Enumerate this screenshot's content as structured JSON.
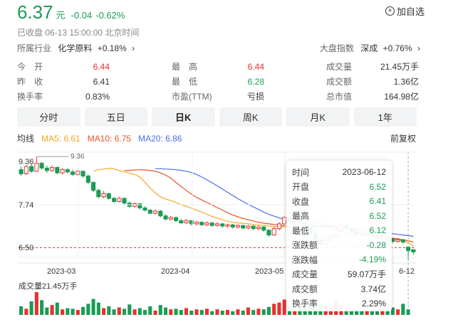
{
  "quote": {
    "price": "6.37",
    "unit": "元",
    "change": "-0.04",
    "change_pct": "-0.62%",
    "watch_label": "加自选",
    "status": "已收盘  06-13 15:00:00  北京时间"
  },
  "industry": {
    "label": "所属行业",
    "name": "化学原料",
    "change": "+0.18%",
    "chevron": "›"
  },
  "index": {
    "label": "大盘指数",
    "name": "深成",
    "change": "+0.76%",
    "chevron": "›"
  },
  "stats": {
    "open_label": "今　开",
    "open": "6.44",
    "high_label": "最　高",
    "high": "6.44",
    "volume_label": "成交量",
    "volume": "21.45万手",
    "prev_label": "昨　收",
    "prev": "6.41",
    "low_label": "最　低",
    "low": "6.28",
    "amount_label": "成交额",
    "amount": "1.36亿",
    "turnover_label": "换手率",
    "turnover": "0.83%",
    "pe_label": "市盈(TTM)",
    "pe": "亏损",
    "mcap_label": "总市值",
    "mcap": "164.98亿"
  },
  "tabs": [
    "分时",
    "五日",
    "日K",
    "周K",
    "月K",
    "1年"
  ],
  "active_tab": 2,
  "ma": {
    "label": "均线",
    "ma5": "MA5: 6.61",
    "ma10": "MA10: 6.75",
    "ma20": "MA20: 6.86",
    "adjust": "前复权"
  },
  "colors": {
    "up": "#e93030",
    "down": "#1a9c56",
    "ma5": "#f5a623",
    "ma10": "#e8542a",
    "ma20": "#4a6ee0"
  },
  "chart": {
    "y_labels": [
      "9.36",
      "7.74",
      "6.50"
    ],
    "high_marker": "9.36",
    "x_labels": [
      "2023-03",
      "2023-04",
      "2023-05",
      "6-12"
    ],
    "volume_label": "成交量21.45万手"
  },
  "chart_data": {
    "type": "candlestick",
    "ylim": [
      6.2,
      9.5
    ],
    "candles": [
      {
        "o": 8.95,
        "c": 8.82,
        "h": 9.05,
        "l": 8.75
      },
      {
        "o": 8.82,
        "c": 9.05,
        "h": 9.1,
        "l": 8.78
      },
      {
        "o": 9.05,
        "c": 8.9,
        "h": 9.12,
        "l": 8.85
      },
      {
        "o": 8.9,
        "c": 9.15,
        "h": 9.36,
        "l": 8.88
      },
      {
        "o": 9.15,
        "c": 9.0,
        "h": 9.2,
        "l": 8.95
      },
      {
        "o": 9.0,
        "c": 8.92,
        "h": 9.08,
        "l": 8.85
      },
      {
        "o": 8.92,
        "c": 9.02,
        "h": 9.08,
        "l": 8.88
      },
      {
        "o": 9.02,
        "c": 8.85,
        "h": 9.05,
        "l": 8.8
      },
      {
        "o": 8.85,
        "c": 8.95,
        "h": 9.0,
        "l": 8.8
      },
      {
        "o": 8.95,
        "c": 8.88,
        "h": 9.0,
        "l": 8.82
      },
      {
        "o": 8.88,
        "c": 8.8,
        "h": 8.95,
        "l": 8.75
      },
      {
        "o": 8.8,
        "c": 8.9,
        "h": 8.95,
        "l": 8.76
      },
      {
        "o": 8.9,
        "c": 8.75,
        "h": 8.92,
        "l": 8.7
      },
      {
        "o": 8.75,
        "c": 8.55,
        "h": 8.8,
        "l": 8.5
      },
      {
        "o": 8.55,
        "c": 8.3,
        "h": 8.58,
        "l": 8.25
      },
      {
        "o": 8.3,
        "c": 8.1,
        "h": 8.35,
        "l": 8.05
      },
      {
        "o": 8.1,
        "c": 8.2,
        "h": 8.28,
        "l": 8.05
      },
      {
        "o": 8.2,
        "c": 8.05,
        "h": 8.22,
        "l": 8.0
      },
      {
        "o": 8.05,
        "c": 7.95,
        "h": 8.1,
        "l": 7.9
      },
      {
        "o": 7.95,
        "c": 8.05,
        "h": 8.1,
        "l": 7.92
      },
      {
        "o": 8.05,
        "c": 7.9,
        "h": 8.08,
        "l": 7.85
      },
      {
        "o": 7.9,
        "c": 7.8,
        "h": 7.95,
        "l": 7.75
      },
      {
        "o": 7.8,
        "c": 7.88,
        "h": 7.92,
        "l": 7.76
      },
      {
        "o": 7.88,
        "c": 7.75,
        "h": 7.9,
        "l": 7.7
      },
      {
        "o": 7.75,
        "c": 7.68,
        "h": 7.8,
        "l": 7.64
      },
      {
        "o": 7.68,
        "c": 7.58,
        "h": 7.72,
        "l": 7.55
      },
      {
        "o": 7.58,
        "c": 7.65,
        "h": 7.7,
        "l": 7.55
      },
      {
        "o": 7.65,
        "c": 7.5,
        "h": 7.68,
        "l": 7.45
      },
      {
        "o": 7.5,
        "c": 7.4,
        "h": 7.55,
        "l": 7.36
      },
      {
        "o": 7.4,
        "c": 7.45,
        "h": 7.5,
        "l": 7.35
      },
      {
        "o": 7.45,
        "c": 7.35,
        "h": 7.48,
        "l": 7.3
      },
      {
        "o": 7.35,
        "c": 7.28,
        "h": 7.4,
        "l": 7.25
      },
      {
        "o": 7.28,
        "c": 7.35,
        "h": 7.4,
        "l": 7.25
      },
      {
        "o": 7.35,
        "c": 7.25,
        "h": 7.38,
        "l": 7.2
      },
      {
        "o": 7.25,
        "c": 7.3,
        "h": 7.35,
        "l": 7.2
      },
      {
        "o": 7.3,
        "c": 7.22,
        "h": 7.33,
        "l": 7.18
      },
      {
        "o": 7.22,
        "c": 7.28,
        "h": 7.32,
        "l": 7.18
      },
      {
        "o": 7.28,
        "c": 7.2,
        "h": 7.3,
        "l": 7.15
      },
      {
        "o": 7.2,
        "c": 7.25,
        "h": 7.3,
        "l": 7.16
      },
      {
        "o": 7.25,
        "c": 7.18,
        "h": 7.28,
        "l": 7.12
      },
      {
        "o": 7.18,
        "c": 7.22,
        "h": 7.26,
        "l": 7.12
      },
      {
        "o": 7.22,
        "c": 7.15,
        "h": 7.25,
        "l": 7.1
      },
      {
        "o": 7.15,
        "c": 7.2,
        "h": 7.24,
        "l": 7.1
      },
      {
        "o": 7.2,
        "c": 7.12,
        "h": 7.22,
        "l": 7.08
      },
      {
        "o": 7.12,
        "c": 7.18,
        "h": 7.22,
        "l": 7.08
      },
      {
        "o": 7.18,
        "c": 7.1,
        "h": 7.2,
        "l": 7.05
      },
      {
        "o": 7.1,
        "c": 7.15,
        "h": 7.2,
        "l": 7.05
      },
      {
        "o": 7.15,
        "c": 7.05,
        "h": 7.18,
        "l": 7.0
      },
      {
        "o": 7.05,
        "c": 6.9,
        "h": 7.08,
        "l": 6.85
      },
      {
        "o": 6.9,
        "c": 7.1,
        "h": 7.15,
        "l": 6.88
      },
      {
        "o": 7.1,
        "c": 7.25,
        "h": 7.3,
        "l": 7.05
      },
      {
        "o": 7.25,
        "c": 7.45,
        "h": 7.5,
        "l": 7.2
      },
      {
        "o": 7.45,
        "c": 7.3,
        "h": 7.5,
        "l": 7.25
      },
      {
        "o": 7.3,
        "c": 7.4,
        "h": 7.45,
        "l": 7.25
      },
      {
        "o": 7.4,
        "c": 7.3,
        "h": 7.45,
        "l": 7.25
      },
      {
        "o": 7.3,
        "c": 7.15,
        "h": 7.35,
        "l": 7.1
      },
      {
        "o": 7.15,
        "c": 6.95,
        "h": 7.2,
        "l": 6.9
      },
      {
        "o": 6.95,
        "c": 6.75,
        "h": 7.0,
        "l": 6.7
      },
      {
        "o": 6.75,
        "c": 6.6,
        "h": 6.8,
        "l": 6.5
      },
      {
        "o": 6.6,
        "c": 6.72,
        "h": 6.8,
        "l": 6.55
      },
      {
        "o": 6.72,
        "c": 6.85,
        "h": 6.9,
        "l": 6.68
      },
      {
        "o": 6.85,
        "c": 7.05,
        "h": 7.1,
        "l": 6.8
      },
      {
        "o": 7.05,
        "c": 7.2,
        "h": 7.3,
        "l": 7.0
      },
      {
        "o": 7.2,
        "c": 7.1,
        "h": 7.25,
        "l": 7.05
      },
      {
        "o": 7.1,
        "c": 7.0,
        "h": 7.15,
        "l": 6.95
      },
      {
        "o": 7.0,
        "c": 6.95,
        "h": 7.05,
        "l": 6.9
      },
      {
        "o": 6.95,
        "c": 6.9,
        "h": 7.0,
        "l": 6.85
      },
      {
        "o": 6.9,
        "c": 6.95,
        "h": 7.0,
        "l": 6.85
      },
      {
        "o": 6.95,
        "c": 6.88,
        "h": 6.98,
        "l": 6.84
      },
      {
        "o": 6.88,
        "c": 6.8,
        "h": 6.9,
        "l": 6.76
      },
      {
        "o": 6.8,
        "c": 6.85,
        "h": 6.9,
        "l": 6.76
      },
      {
        "o": 6.85,
        "c": 6.78,
        "h": 6.88,
        "l": 6.72
      },
      {
        "o": 6.78,
        "c": 6.7,
        "h": 6.8,
        "l": 6.65
      },
      {
        "o": 6.7,
        "c": 6.75,
        "h": 6.8,
        "l": 6.66
      },
      {
        "o": 6.75,
        "c": 6.68,
        "h": 6.78,
        "l": 6.62
      },
      {
        "o": 6.52,
        "c": 6.41,
        "h": 6.52,
        "l": 6.12
      },
      {
        "o": 6.44,
        "c": 6.37,
        "h": 6.44,
        "l": 6.28
      }
    ],
    "volumes": [
      14,
      10,
      22,
      37,
      24,
      12,
      16,
      20,
      9,
      11,
      10,
      8,
      13,
      18,
      26,
      20,
      11,
      14,
      9,
      12,
      10,
      17,
      9,
      11,
      8,
      14,
      7,
      16,
      12,
      9,
      10,
      8,
      11,
      7,
      9,
      8,
      10,
      6,
      9,
      7,
      8,
      6,
      9,
      7,
      12,
      8,
      10,
      9,
      13,
      18,
      20,
      25,
      13,
      10,
      11,
      14,
      16,
      21,
      19,
      15,
      12,
      22,
      17,
      11,
      9,
      10,
      8,
      7,
      9,
      6,
      10,
      8,
      12,
      9,
      18,
      9
    ],
    "ma5": [
      8.9,
      8.95,
      8.97,
      8.99,
      8.98,
      8.92,
      8.88,
      8.84,
      8.8,
      8.72,
      8.55,
      8.38,
      8.22,
      8.1,
      8.03,
      7.98,
      7.92,
      7.85,
      7.8,
      7.74,
      7.68,
      7.62,
      7.55,
      7.48,
      7.43,
      7.38,
      7.33,
      7.3,
      7.28,
      7.27,
      7.25,
      7.23,
      7.21,
      7.2,
      7.18,
      7.17,
      7.16,
      7.15,
      7.12,
      7.08,
      7.05,
      7.1,
      7.2,
      7.3,
      7.33,
      7.25,
      7.1,
      6.95,
      6.85,
      6.8,
      6.85,
      6.95,
      7.0,
      6.98,
      6.95,
      6.9,
      6.86,
      6.82,
      6.78,
      6.75,
      6.72,
      6.66,
      6.55
    ],
    "ma10": [
      8.92,
      8.93,
      8.94,
      8.95,
      8.94,
      8.92,
      8.9,
      8.85,
      8.78,
      8.68,
      8.55,
      8.42,
      8.3,
      8.18,
      8.08,
      8.0,
      7.92,
      7.84,
      7.76,
      7.68,
      7.6,
      7.53,
      7.47,
      7.42,
      7.38,
      7.34,
      7.3,
      7.27,
      7.25,
      7.23,
      7.21,
      7.19,
      7.17,
      7.15,
      7.13,
      7.12,
      7.13,
      7.16,
      7.2,
      7.22,
      7.2,
      7.12,
      7.03,
      6.96,
      6.92,
      6.92,
      6.94,
      6.94,
      6.92,
      6.88,
      6.85,
      6.82,
      6.8,
      6.78,
      6.75,
      6.72,
      6.68
    ],
    "ma20": [
      8.98,
      8.98,
      8.97,
      8.96,
      8.95,
      8.93,
      8.9,
      8.86,
      8.8,
      8.72,
      8.63,
      8.54,
      8.44,
      8.34,
      8.24,
      8.14,
      8.04,
      7.95,
      7.86,
      7.78,
      7.7,
      7.62,
      7.55,
      7.49,
      7.44,
      7.39,
      7.35,
      7.31,
      7.28,
      7.25,
      7.22,
      7.2,
      7.18,
      7.17,
      7.16,
      7.15,
      7.14,
      7.12,
      7.1,
      7.08,
      7.06,
      7.04,
      7.02,
      7.0,
      6.98,
      6.96,
      6.94,
      6.92,
      6.9,
      6.88,
      6.86
    ]
  },
  "tooltip": {
    "rows": [
      {
        "label": "时间",
        "value": "2023-06-12",
        "color": "#333"
      },
      {
        "label": "开盘",
        "value": "6.52",
        "color": "#1a9c56"
      },
      {
        "label": "收盘",
        "value": "6.41",
        "color": "#1a9c56"
      },
      {
        "label": "最高",
        "value": "6.52",
        "color": "#1a9c56"
      },
      {
        "label": "最低",
        "value": "6.12",
        "color": "#1a9c56"
      },
      {
        "label": "涨跌额",
        "value": "-0.28",
        "color": "#1a9c56"
      },
      {
        "label": "涨跌幅",
        "value": "-4.19%",
        "color": "#1a9c56"
      },
      {
        "label": "成交量",
        "value": "59.07万手",
        "color": "#333"
      },
      {
        "label": "成交额",
        "value": "3.74亿",
        "color": "#333"
      },
      {
        "label": "换手率",
        "value": "2.29%",
        "color": "#333"
      }
    ]
  }
}
